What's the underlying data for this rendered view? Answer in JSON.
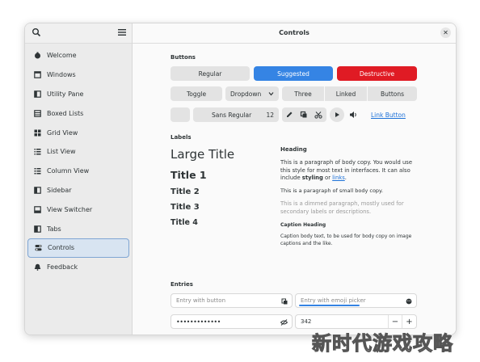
{
  "sidebar": {
    "items": [
      {
        "label": "Welcome",
        "icon": "welcome-icon"
      },
      {
        "label": "Windows",
        "icon": "window-icon"
      },
      {
        "label": "Utility Pane",
        "icon": "utility-pane-icon"
      },
      {
        "label": "Boxed Lists",
        "icon": "boxed-list-icon"
      },
      {
        "label": "Grid View",
        "icon": "grid-view-icon"
      },
      {
        "label": "List View",
        "icon": "list-view-icon"
      },
      {
        "label": "Column View",
        "icon": "column-view-icon"
      },
      {
        "label": "Sidebar",
        "icon": "sidebar-icon"
      },
      {
        "label": "View Switcher",
        "icon": "view-switcher-icon"
      },
      {
        "label": "Tabs",
        "icon": "tabs-icon"
      },
      {
        "label": "Controls",
        "icon": "controls-icon",
        "active": true
      },
      {
        "label": "Feedback",
        "icon": "bell-icon"
      }
    ]
  },
  "header": {
    "title": "Controls"
  },
  "buttons": {
    "section": "Buttons",
    "regular": "Regular",
    "suggested": "Suggested",
    "destructive": "Destructive",
    "toggle": "Toggle",
    "dropdown": "Dropdown",
    "linked": [
      "Three",
      "Linked",
      "Buttons"
    ],
    "font": "Sans Regular",
    "font_size": "12",
    "link_button": "Link Button"
  },
  "labels": {
    "section": "Labels",
    "large_title": "Large Title",
    "title1": "Title 1",
    "title2": "Title 2",
    "title3": "Title 3",
    "title4": "Title 4",
    "heading": "Heading",
    "body_pre": "This is a paragraph of body copy. You would use this style for most text in interfaces. It can also include ",
    "body_bold": "styling",
    "body_mid": " or ",
    "body_link": "links",
    "body_end": ".",
    "small": "This is a paragraph of small body copy.",
    "dim": "This is a dimmed paragraph, mostly used for secondary labels or descriptions.",
    "caption_heading": "Caption Heading",
    "caption": "Caption body text, to be used for body copy on image captions and the like."
  },
  "entries": {
    "section": "Entries",
    "with_button_placeholder": "Entry with button",
    "emoji_placeholder": "Entry with emoji picker",
    "password_value": "•••••••••••••",
    "spin_value": "342"
  },
  "watermark": "新时代游戏攻略",
  "colors": {
    "accent": "#3584e4",
    "destructive": "#e01b24",
    "link": "#1c71d8"
  }
}
